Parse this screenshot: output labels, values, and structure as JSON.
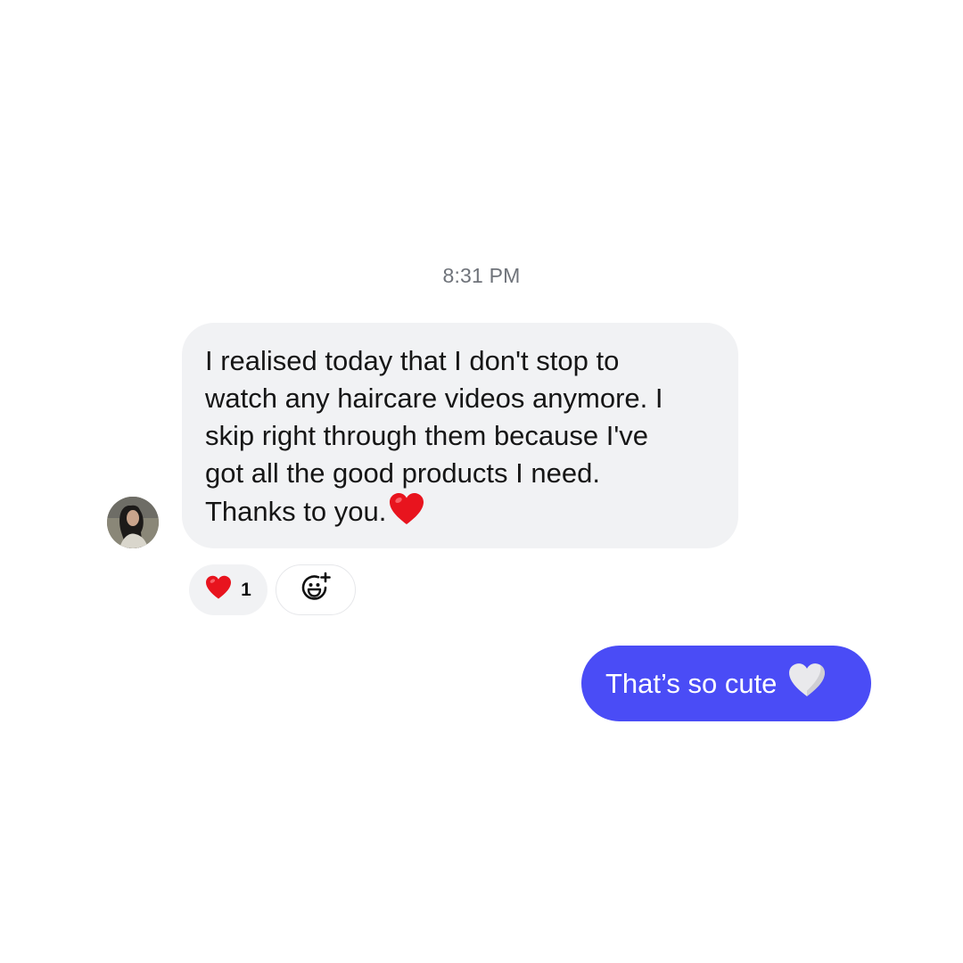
{
  "conversation": {
    "timestamp": "8:31 PM",
    "incoming_message": {
      "lines": [
        "I realised today that I don't stop to",
        "watch any haircare videos anymore. I",
        "skip right through them because I've",
        "got all the good products I need.",
        "Thanks to you."
      ],
      "trailing_emoji": "red-heart-icon",
      "avatar": "sender-avatar"
    },
    "reactions": {
      "emoji": "red-heart-icon",
      "count": "1",
      "add_icon": "add-reaction-smiley-icon"
    },
    "outgoing_message": {
      "text": "That’s so cute",
      "trailing_emoji": "white-heart-icon"
    }
  },
  "colors": {
    "background": "#ffffff",
    "incoming_bubble": "#f1f2f4",
    "outgoing_bubble": "#4a4cf6",
    "timestamp_text": "#6f737a",
    "heart_red": "#e8141e"
  }
}
